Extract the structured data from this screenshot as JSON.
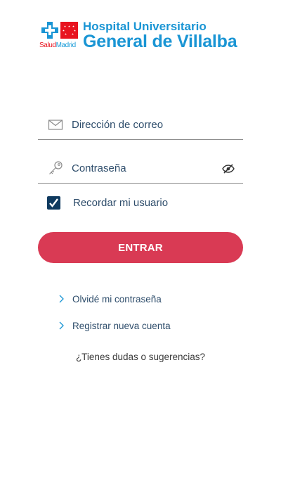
{
  "header": {
    "brand_part1": "Salud",
    "brand_part2": "Madrid",
    "title_line1": "Hospital Universitario",
    "title_line2": "General de Villalba"
  },
  "form": {
    "email_placeholder": "Dirección de correo",
    "email_value": "",
    "password_placeholder": "Contraseña",
    "password_value": "",
    "remember_label": "Recordar mi usuario",
    "remember_checked": true,
    "submit_label": "ENTRAR"
  },
  "links": {
    "forgot": "Olvidé mi contraseña",
    "register": "Registrar nueva cuenta",
    "help": "¿Tienes dudas o sugerencias?"
  },
  "colors": {
    "brand_blue": "#1a95d4",
    "madrid_red": "#e8131f",
    "button": "#d93a54",
    "checkbox": "#0f3a5f",
    "text": "#2e4d6b"
  },
  "icons": {
    "email": "envelope-icon",
    "password": "key-icon",
    "toggle_visibility": "eye-slash-icon",
    "link_arrow": "chevron-right-icon"
  }
}
